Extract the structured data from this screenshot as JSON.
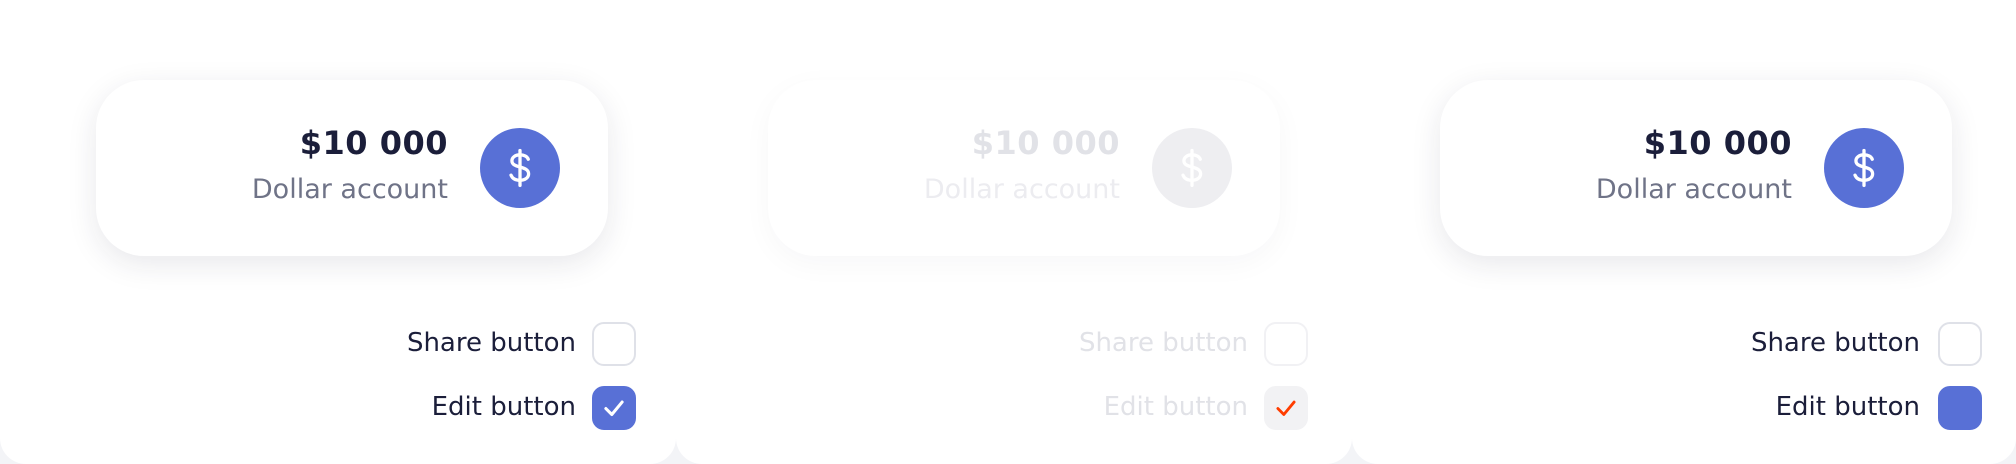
{
  "colors": {
    "accent": "#5870d6",
    "text_primary": "#1b1e3a",
    "text_secondary": "#6f7387",
    "disabled_text": "#e1e2e7",
    "disabled_check": "#ff3d00"
  },
  "states": [
    {
      "card": {
        "amount": "$10 000",
        "label": "Dollar account",
        "icon": "dollar-icon"
      },
      "options": [
        {
          "label": "Share button",
          "checked": false
        },
        {
          "label": "Edit button",
          "checked": true
        }
      ]
    },
    {
      "card": {
        "amount": "$10 000",
        "label": "Dollar account",
        "icon": "dollar-icon"
      },
      "options": [
        {
          "label": "Share button",
          "checked": false
        },
        {
          "label": "Edit button",
          "checked": true
        }
      ]
    },
    {
      "card": {
        "amount": "$10 000",
        "label": "Dollar account",
        "icon": "dollar-icon"
      },
      "options": [
        {
          "label": "Share button",
          "checked": false
        },
        {
          "label": "Edit button",
          "checked": true
        }
      ]
    }
  ]
}
